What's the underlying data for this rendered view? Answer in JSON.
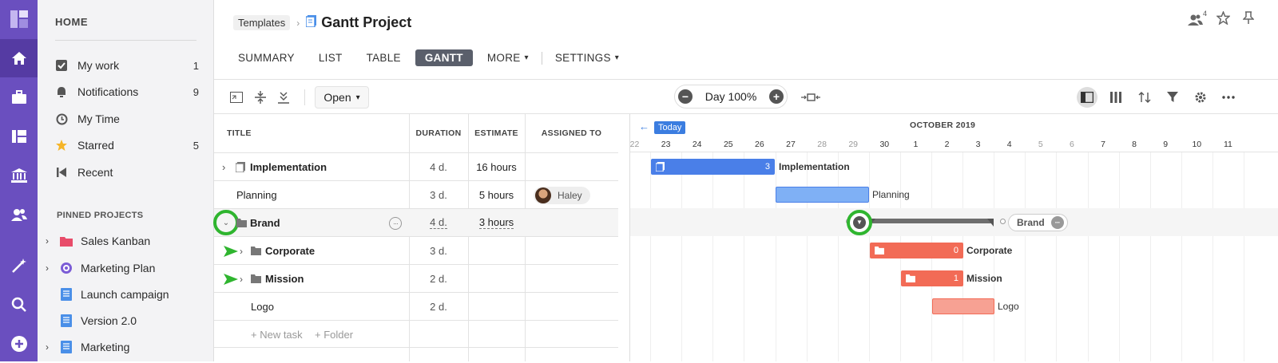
{
  "sidebar": {
    "home_label": "HOME",
    "items": [
      {
        "label": "My work",
        "count": "1"
      },
      {
        "label": "Notifications",
        "count": "9"
      },
      {
        "label": "My Time",
        "count": ""
      },
      {
        "label": "Starred",
        "count": "5"
      },
      {
        "label": "Recent",
        "count": ""
      }
    ],
    "pinned_label": "PINNED PROJECTS",
    "pinned": [
      {
        "label": "Sales Kanban"
      },
      {
        "label": "Marketing Plan"
      },
      {
        "label": "Launch campaign"
      },
      {
        "label": "Version 2.0"
      },
      {
        "label": "Marketing"
      }
    ]
  },
  "header": {
    "breadcrumb": "Templates",
    "title": "Gantt Project",
    "members_count": "4"
  },
  "tabs": [
    "SUMMARY",
    "LIST",
    "TABLE",
    "GANTT",
    "MORE",
    "SETTINGS"
  ],
  "toolbar": {
    "open_label": "Open",
    "zoom_label": "Day 100%"
  },
  "grid": {
    "headers": {
      "title": "TITLE",
      "duration": "DURATION",
      "estimate": "ESTIMATE",
      "assigned": "ASSIGNED TO"
    },
    "rows": [
      {
        "title": "Implementation",
        "duration": "4 d.",
        "estimate": "16 hours",
        "assigned": ""
      },
      {
        "title": "Planning",
        "duration": "3 d.",
        "estimate": "5 hours",
        "assigned": "Haley"
      },
      {
        "title": "Brand",
        "duration": "4 d.",
        "estimate": "3 hours",
        "assigned": ""
      },
      {
        "title": "Corporate",
        "duration": "3 d.",
        "estimate": "",
        "assigned": ""
      },
      {
        "title": "Mission",
        "duration": "2 d.",
        "estimate": "",
        "assigned": ""
      },
      {
        "title": "Logo",
        "duration": "2 d.",
        "estimate": "",
        "assigned": ""
      }
    ],
    "new_task": "+ New task",
    "new_folder": "+ Folder"
  },
  "gantt": {
    "today_label": "Today",
    "month": "OCTOBER 2019",
    "days": [
      "22",
      "23",
      "24",
      "25",
      "26",
      "27",
      "28",
      "29",
      "30",
      "1",
      "2",
      "3",
      "4",
      "5",
      "6",
      "7",
      "8",
      "9",
      "10",
      "11"
    ],
    "bars": [
      {
        "label": "Implementation",
        "count": "3"
      },
      {
        "label": "Planning"
      },
      {
        "label": "Brand"
      },
      {
        "label": "Corporate",
        "count": "0"
      },
      {
        "label": "Mission",
        "count": "1"
      },
      {
        "label": "Logo"
      }
    ]
  },
  "colors": {
    "rail": "#6a4fbf",
    "blue": "#4a7fe8",
    "light_blue": "#7fb0f5",
    "coral": "#f26b56",
    "light_coral": "#f7a193",
    "green": "#2fb52f"
  }
}
